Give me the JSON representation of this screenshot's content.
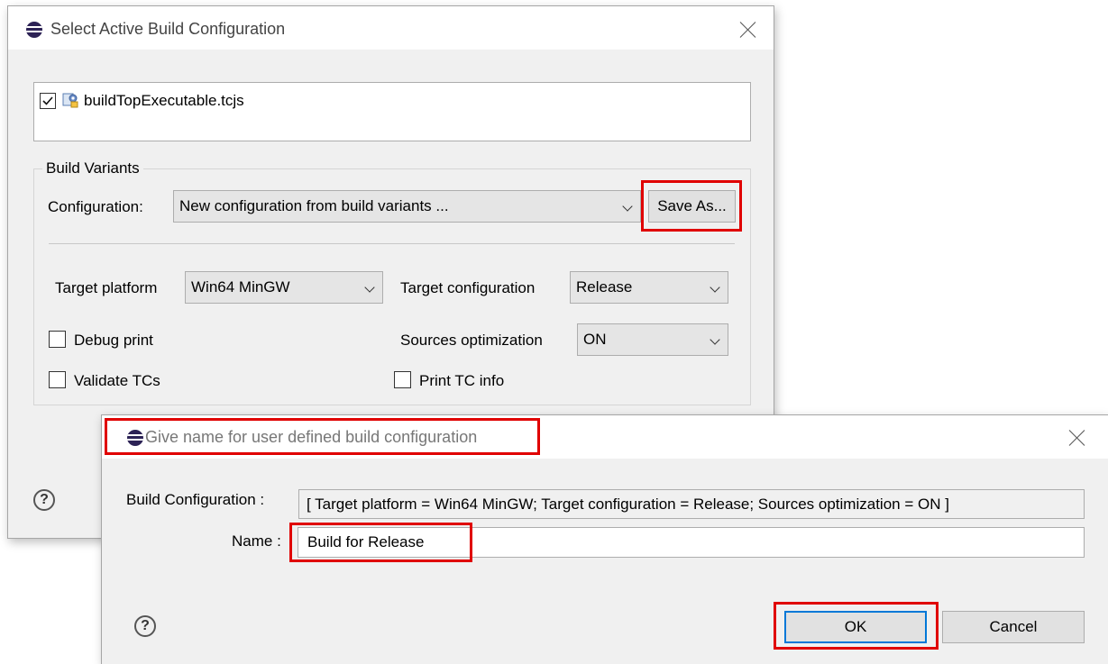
{
  "main_dialog": {
    "title": "Select Active Build Configuration",
    "file_item": "buildTopExecutable.tcjs",
    "file_checked": true,
    "group_label": "Build Variants",
    "configuration_label": "Configuration:",
    "configuration_value": "New configuration from build variants ...",
    "save_as_label": "Save As...",
    "target_platform_label": "Target platform",
    "target_platform_value": "Win64 MinGW",
    "target_configuration_label": "Target configuration",
    "target_configuration_value": "Release",
    "debug_print_label": "Debug print",
    "sources_optimization_label": "Sources optimization",
    "sources_optimization_value": "ON",
    "validate_tcs_label": "Validate TCs",
    "print_tc_info_label": "Print TC info",
    "help_symbol": "?"
  },
  "name_dialog": {
    "title": "Give name for user defined build configuration",
    "build_configuration_label": "Build Configuration :",
    "build_configuration_value": "[ Target platform = Win64 MinGW; Target configuration = Release; Sources optimization = ON ]",
    "name_label": "Name :",
    "name_value": "Build for Release",
    "ok_label": "OK",
    "cancel_label": "Cancel",
    "help_symbol": "?"
  },
  "icons": {
    "app": "eclipse-icon",
    "close": "close-icon",
    "file": "build-file-icon",
    "help": "help-icon",
    "dropdown": "chevron-down-icon"
  },
  "colors": {
    "highlight": "#e00000",
    "dialog_bg": "#f0f0f0",
    "default_button_border": "#0078d7"
  }
}
